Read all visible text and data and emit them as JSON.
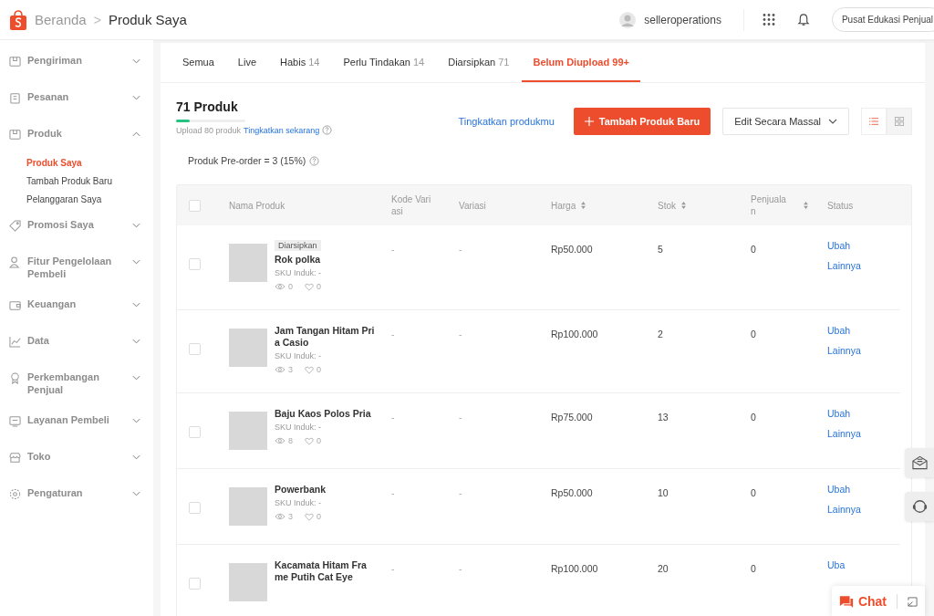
{
  "header": {
    "breadcrumb": [
      {
        "label": "Beranda",
        "current": false
      },
      {
        "label": "Produk Saya",
        "current": true
      }
    ],
    "separator": ">",
    "username": "selleroperations",
    "education_button": "Pusat Edukasi Penjual"
  },
  "sidebar": {
    "items": [
      {
        "label": "Pengiriman",
        "expanded": false
      },
      {
        "label": "Pesanan",
        "expanded": false
      },
      {
        "label": "Produk",
        "expanded": true,
        "children": [
          {
            "label": "Produk Saya",
            "selected": true
          },
          {
            "label": "Tambah Produk Baru",
            "selected": false
          },
          {
            "label": "Pelanggaran Saya",
            "selected": false
          }
        ]
      },
      {
        "label": "Promosi Saya",
        "expanded": false
      },
      {
        "label": "Fitur Pengelolaan Pembeli",
        "expanded": false
      },
      {
        "label": "Keuangan",
        "expanded": false
      },
      {
        "label": "Data",
        "expanded": false
      },
      {
        "label": "Perkembangan Penjual",
        "expanded": false
      },
      {
        "label": "Layanan Pembeli",
        "expanded": false
      },
      {
        "label": "Toko",
        "expanded": false
      },
      {
        "label": "Pengaturan",
        "expanded": false
      }
    ]
  },
  "tabs": [
    {
      "label": "Semua",
      "selected": false
    },
    {
      "label": "Live",
      "selected": false
    },
    {
      "label": "Habis",
      "count": "14",
      "selected": false
    },
    {
      "label": "Perlu Tindakan",
      "count": "14",
      "selected": false
    },
    {
      "label": "Diarsipkan",
      "count": "71",
      "selected": false
    },
    {
      "label": "Belum Diupload",
      "count": "99+",
      "selected": true
    }
  ],
  "summary": {
    "title": "71 Produk",
    "level": 0.2,
    "quota_text": "Upload 80 produk",
    "upgrade_link": "Tingkatkan sekarang"
  },
  "actions": {
    "upgrade_products": "Tingkatkan produkmu",
    "add_button": "Tambah Produk Baru",
    "bulk_edit": "Edit Secara Massal",
    "view_modes": [
      {
        "kind": "list",
        "selected": true
      },
      {
        "kind": "grid",
        "selected": false
      }
    ]
  },
  "preorder": "Produk Pre-order = 3 (15%)",
  "table": {
    "select_all_checked": false,
    "columns": [
      {
        "label": "Nama Produk",
        "sortable": false
      },
      {
        "label": "Kode Variasi",
        "sortable": false
      },
      {
        "label": "Variasi",
        "sortable": false
      },
      {
        "label": "Harga",
        "sortable": true
      },
      {
        "label": "Stok",
        "sortable": true
      },
      {
        "label": "Penjualan",
        "sortable": true
      },
      {
        "label": "Status",
        "sortable": false
      }
    ],
    "rows": [
      {
        "checked": false,
        "badge": "Diarsipkan",
        "name": "Rok polka",
        "sku": "SKU Induk: -",
        "views": "0",
        "likes": "0",
        "variant_code": "-",
        "variation": "-",
        "price": "Rp50.000",
        "stock": "5",
        "sales": "0",
        "actions": [
          "Ubah",
          "Lainnya"
        ]
      },
      {
        "checked": false,
        "name": "Jam Tangan Hitam Pria Casio",
        "sku": "SKU Induk: -",
        "views": "3",
        "likes": "0",
        "variant_code": "-",
        "variation": "-",
        "price": "Rp100.000",
        "stock": "2",
        "sales": "0",
        "actions": [
          "Ubah",
          "Lainnya"
        ]
      },
      {
        "checked": false,
        "name": "Baju Kaos Polos Pria",
        "sku": "SKU Induk: -",
        "views": "8",
        "likes": "0",
        "variant_code": "-",
        "variation": "-",
        "price": "Rp75.000",
        "stock": "13",
        "sales": "0",
        "actions": [
          "Ubah",
          "Lainnya"
        ]
      },
      {
        "checked": false,
        "name": "Powerbank",
        "sku": "SKU Induk: -",
        "views": "3",
        "likes": "0",
        "variant_code": "-",
        "variation": "-",
        "price": "Rp50.000",
        "stock": "10",
        "sales": "0",
        "actions": [
          "Ubah",
          "Lainnya"
        ]
      },
      {
        "checked": false,
        "name": "Kacamata Hitam Frame Putih Cat Eye",
        "variant_code": "-",
        "variation": "-",
        "price": "Rp100.000",
        "stock": "20",
        "sales": "0",
        "actions": [
          "Uba"
        ]
      }
    ]
  },
  "chat": {
    "label": "Chat"
  }
}
